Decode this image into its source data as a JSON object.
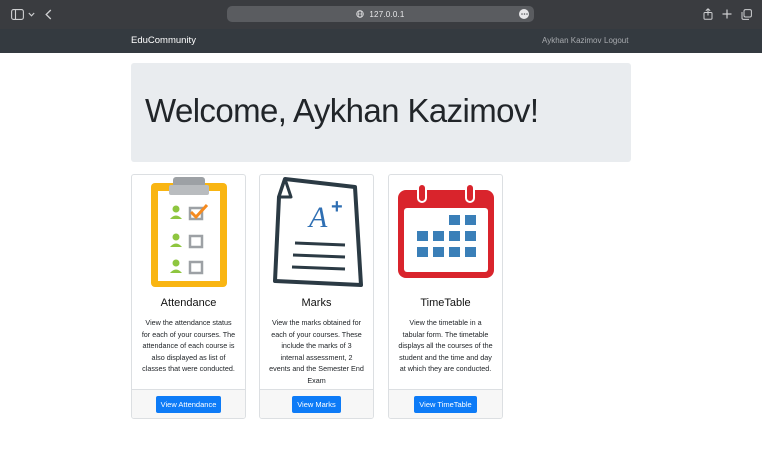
{
  "browser": {
    "url": "127.0.0.1"
  },
  "navbar": {
    "brand": "EduCommunity",
    "user_name": "Aykhan Kazimov",
    "logout": "Logout"
  },
  "jumbotron": {
    "heading": "Welcome, Aykhan Kazimov!"
  },
  "cards": [
    {
      "title": "Attendance",
      "text": "View the attendance status for each of your courses. The attendance of each course is also displayed as list of classes that were conducted.",
      "button": "View Attendance",
      "icon": "attendance-clipboard-icon"
    },
    {
      "title": "Marks",
      "text": "View the marks obtained for each of your courses. These include the marks of 3 internal assessment, 2 events and the Semester End Exam",
      "button": "View Marks",
      "icon": "a-plus-document-icon"
    },
    {
      "title": "TimeTable",
      "text": "View the timetable in a tabular form. The timetable displays all the courses of the student and the time and day at which they are conducted.",
      "button": "View TimeTable",
      "icon": "calendar-icon"
    }
  ],
  "colors": {
    "navbar_bg": "#343a40",
    "jumbotron_bg": "#e9ecef",
    "primary_button": "#0d7bf7",
    "clipboard_yellow": "#f9b512",
    "calendar_red": "#d9242c",
    "calendar_blue": "#3a7fb8"
  }
}
